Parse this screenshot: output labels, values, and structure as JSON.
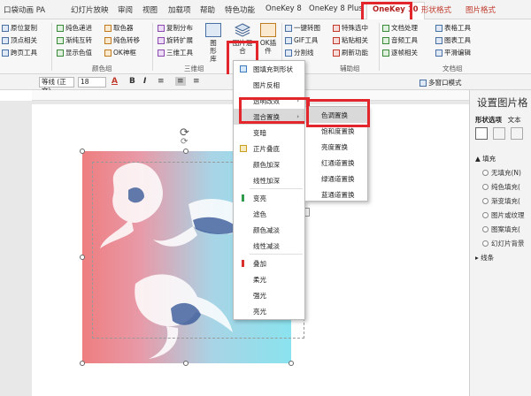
{
  "tabs": [
    {
      "label": "口袋动画 PA"
    },
    {
      "label": "幻灯片放映"
    },
    {
      "label": "审阅"
    },
    {
      "label": "视图"
    },
    {
      "label": "加载项"
    },
    {
      "label": "帮助"
    },
    {
      "label": "特色功能"
    },
    {
      "label": "OneKey 8"
    },
    {
      "label": "OneKey 8 Plus"
    },
    {
      "label": "OneKey 10"
    },
    {
      "label": "形状格式"
    },
    {
      "label": "图片格式"
    }
  ],
  "ribbon": {
    "col1": [
      "原位复制",
      "顶点相关",
      "跨页工具"
    ],
    "col2": [
      "纯色递进",
      "渐纯互转",
      "显示色值"
    ],
    "col3": [
      "取色器",
      "纯色转移",
      "OK神框"
    ],
    "group_color": "颜色组",
    "col4": [
      "复制分布",
      "旋转扩展",
      "三维工具"
    ],
    "group_3d": "三维组",
    "btn_library": "图形库",
    "btn_mix": [
      "图片混",
      "合"
    ],
    "btn_ok": [
      "OK插",
      "件"
    ],
    "col5": [
      "一键转图",
      "GIF工具",
      "分割线"
    ],
    "col6": [
      "特殊选中",
      "粘贴相关",
      "刷新功能"
    ],
    "group_aux": "辅助组",
    "col7": [
      "文档处理",
      "音频工具",
      "逐帧相关"
    ],
    "col8": [
      "表格工具",
      "图表工具",
      "平滑编辑"
    ],
    "group_doc": "文档组"
  },
  "fmt": {
    "font": "等线 (正文)",
    "size": "18",
    "bold": "B",
    "italic": "I",
    "window": "多窗口模式"
  },
  "pane": {
    "title": "设置图片格",
    "tab1": "形状选项",
    "tab2": "文本",
    "fill_section": "填充",
    "fill_options": [
      "无填充(N)",
      "纯色填充(",
      "渐变填充(",
      "图片或纹理",
      "图案填充(",
      "幻灯片背景"
    ],
    "line_section": "线条"
  },
  "menu_main": {
    "items": [
      "图填充到形状",
      "图片反相",
      "透明改效",
      "混合置换",
      "变暗",
      "正片叠底",
      "颜色加深",
      "线性加深",
      "变亮",
      "滤色",
      "颜色减淡",
      "线性减淡",
      "叠加",
      "柔光",
      "强光",
      "亮光"
    ],
    "selected": "混合置换"
  },
  "menu_sub": {
    "items": [
      "色调置换",
      "饱和度置换",
      "亮度置换",
      "红通道置换",
      "绿通道置换",
      "蓝通道置换"
    ],
    "selected": "色调置换"
  },
  "colors": {
    "accent": "#b22222",
    "highlight": "#e3262b",
    "gradient_left": "#ee7e80",
    "gradient_right": "#8ae3ee"
  }
}
